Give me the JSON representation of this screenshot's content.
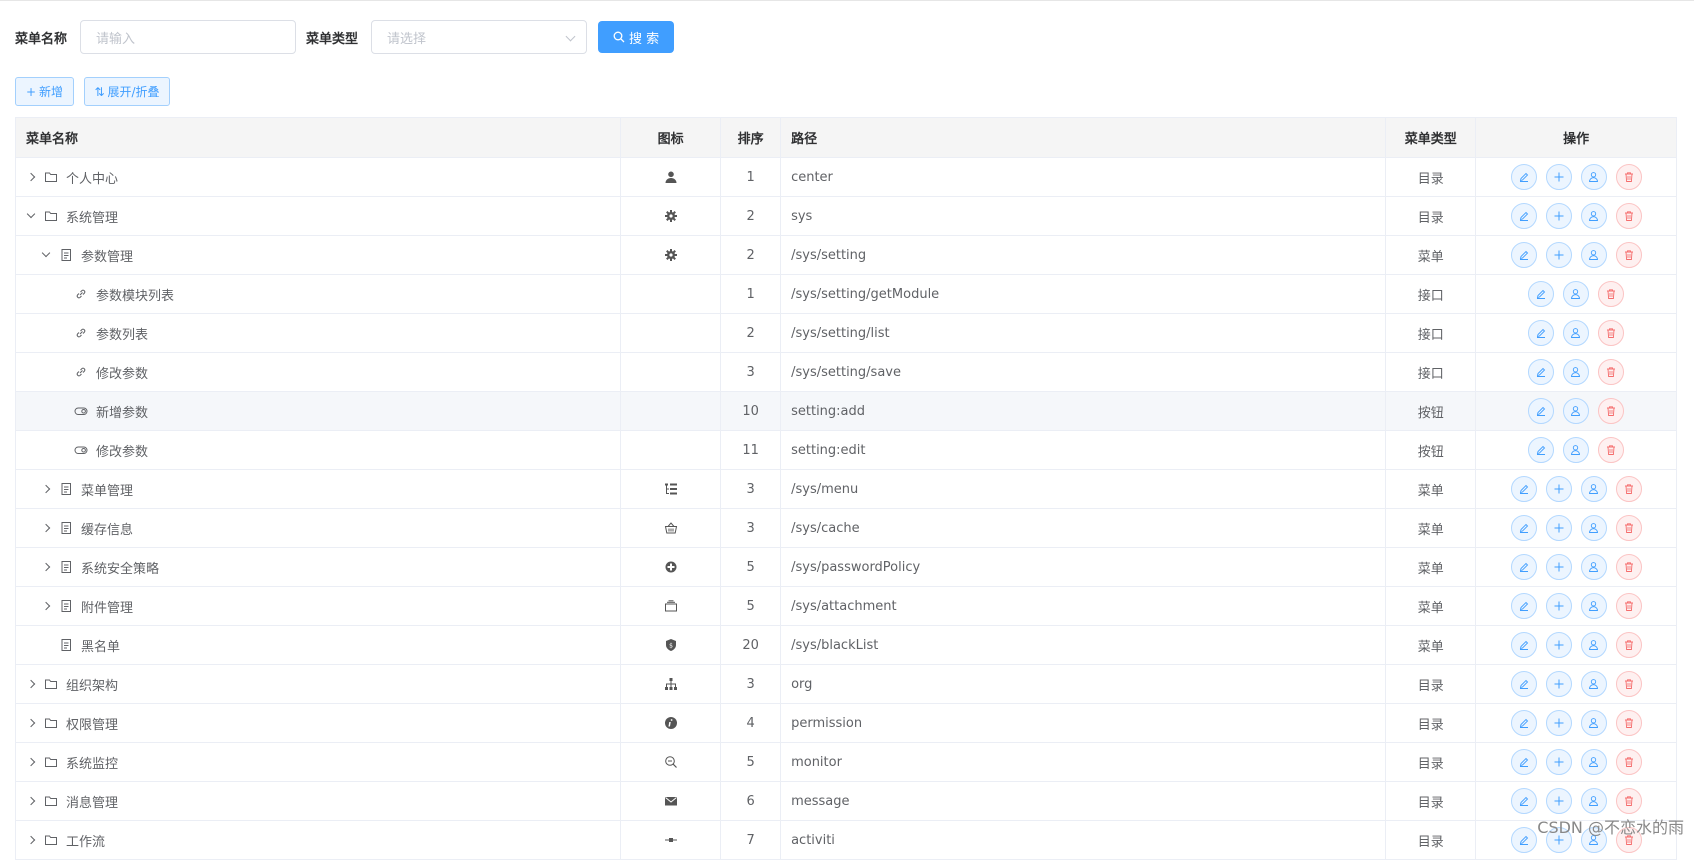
{
  "search": {
    "name_label": "菜单名称",
    "name_placeholder": "请输入",
    "type_label": "菜单类型",
    "type_placeholder": "请选择",
    "search_button": "搜 索"
  },
  "toolbar": {
    "add_label": "新增",
    "expand_label": "展开/折叠"
  },
  "table": {
    "headers": {
      "name": "菜单名称",
      "icon": "图标",
      "sort": "排序",
      "path": "路径",
      "type": "菜单类型",
      "ops": "操作"
    },
    "rows": [
      {
        "name": "个人中心",
        "level": 0,
        "expander": "collapsed",
        "node_icon": "folder-icon",
        "menu_icon": "user-icon",
        "sort": "1",
        "path": "center",
        "type": "目录",
        "ops": [
          "edit",
          "add",
          "assign",
          "delete"
        ]
      },
      {
        "name": "系统管理",
        "level": 0,
        "expander": "expanded",
        "node_icon": "folder-icon",
        "menu_icon": "gear-icon",
        "sort": "2",
        "path": "sys",
        "type": "目录",
        "ops": [
          "edit",
          "add",
          "assign",
          "delete"
        ]
      },
      {
        "name": "参数管理",
        "level": 1,
        "expander": "expanded",
        "node_icon": "document-icon",
        "menu_icon": "gear-icon",
        "sort": "2",
        "path": "/sys/setting",
        "type": "菜单",
        "ops": [
          "edit",
          "add",
          "assign",
          "delete"
        ]
      },
      {
        "name": "参数模块列表",
        "level": 2,
        "expander": "none",
        "node_icon": "link-icon",
        "menu_icon": "",
        "sort": "1",
        "path": "/sys/setting/getModule",
        "type": "接口",
        "ops": [
          "edit",
          "assign",
          "delete"
        ]
      },
      {
        "name": "参数列表",
        "level": 2,
        "expander": "none",
        "node_icon": "link-icon",
        "menu_icon": "",
        "sort": "2",
        "path": "/sys/setting/list",
        "type": "接口",
        "ops": [
          "edit",
          "assign",
          "delete"
        ]
      },
      {
        "name": "修改参数",
        "level": 2,
        "expander": "none",
        "node_icon": "link-icon",
        "menu_icon": "",
        "sort": "3",
        "path": "/sys/setting/save",
        "type": "接口",
        "ops": [
          "edit",
          "assign",
          "delete"
        ]
      },
      {
        "name": "新增参数",
        "level": 2,
        "expander": "none",
        "node_icon": "toggle-icon",
        "menu_icon": "",
        "sort": "10",
        "path": "setting:add",
        "type": "按钮",
        "ops": [
          "edit",
          "assign",
          "delete"
        ]
      },
      {
        "name": "修改参数",
        "level": 2,
        "expander": "none",
        "node_icon": "toggle-icon",
        "menu_icon": "",
        "sort": "11",
        "path": "setting:edit",
        "type": "按钮",
        "ops": [
          "edit",
          "assign",
          "delete"
        ]
      },
      {
        "name": "菜单管理",
        "level": 1,
        "expander": "collapsed",
        "node_icon": "document-icon",
        "menu_icon": "tree-list-icon",
        "sort": "3",
        "path": "/sys/menu",
        "type": "菜单",
        "ops": [
          "edit",
          "add",
          "assign",
          "delete"
        ]
      },
      {
        "name": "缓存信息",
        "level": 1,
        "expander": "collapsed",
        "node_icon": "document-icon",
        "menu_icon": "basket-icon",
        "sort": "3",
        "path": "/sys/cache",
        "type": "菜单",
        "ops": [
          "edit",
          "add",
          "assign",
          "delete"
        ]
      },
      {
        "name": "系统安全策略",
        "level": 1,
        "expander": "collapsed",
        "node_icon": "document-icon",
        "menu_icon": "shield-cross-icon",
        "sort": "5",
        "path": "/sys/passwordPolicy",
        "type": "菜单",
        "ops": [
          "edit",
          "add",
          "assign",
          "delete"
        ]
      },
      {
        "name": "附件管理",
        "level": 1,
        "expander": "collapsed",
        "node_icon": "document-icon",
        "menu_icon": "box-icon",
        "sort": "5",
        "path": "/sys/attachment",
        "type": "菜单",
        "ops": [
          "edit",
          "add",
          "assign",
          "delete"
        ]
      },
      {
        "name": "黑名单",
        "level": 1,
        "expander": "none",
        "node_icon": "document-icon",
        "menu_icon": "shield-icon",
        "sort": "20",
        "path": "/sys/blackList",
        "type": "菜单",
        "ops": [
          "edit",
          "add",
          "assign",
          "delete"
        ]
      },
      {
        "name": "组织架构",
        "level": 0,
        "expander": "collapsed",
        "node_icon": "folder-icon",
        "menu_icon": "org-chart-icon",
        "sort": "3",
        "path": "org",
        "type": "目录",
        "ops": [
          "edit",
          "add",
          "assign",
          "delete"
        ]
      },
      {
        "name": "权限管理",
        "level": 0,
        "expander": "collapsed",
        "node_icon": "folder-icon",
        "menu_icon": "info-icon",
        "sort": "4",
        "path": "permission",
        "type": "目录",
        "ops": [
          "edit",
          "add",
          "assign",
          "delete"
        ]
      },
      {
        "name": "系统监控",
        "level": 0,
        "expander": "collapsed",
        "node_icon": "folder-icon",
        "menu_icon": "zoom-icon",
        "sort": "5",
        "path": "monitor",
        "type": "目录",
        "ops": [
          "edit",
          "add",
          "assign",
          "delete"
        ]
      },
      {
        "name": "消息管理",
        "level": 0,
        "expander": "collapsed",
        "node_icon": "folder-icon",
        "menu_icon": "mail-icon",
        "sort": "6",
        "path": "message",
        "type": "目录",
        "ops": [
          "edit",
          "add",
          "assign",
          "delete"
        ]
      },
      {
        "name": "工作流",
        "level": 0,
        "expander": "collapsed",
        "node_icon": "folder-icon",
        "menu_icon": "flow-icon",
        "sort": "7",
        "path": "activiti",
        "type": "目录",
        "ops": [
          "edit",
          "add",
          "assign",
          "delete"
        ]
      }
    ]
  },
  "watermark": "CSDN @不恋水的雨"
}
